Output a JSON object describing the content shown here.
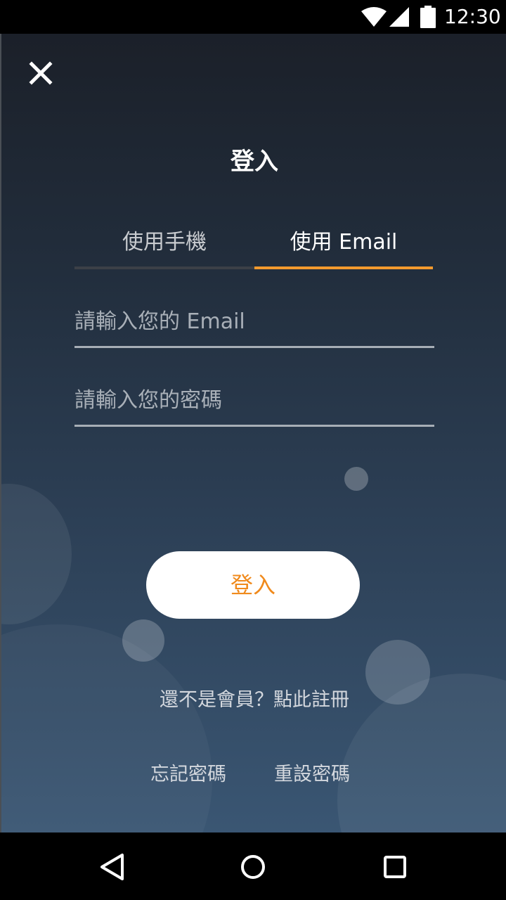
{
  "status_bar": {
    "time": "12:30",
    "icons": [
      "wifi-icon",
      "cell-signal-icon",
      "battery-icon"
    ]
  },
  "header": {
    "close_icon": "close-icon",
    "title": "登入"
  },
  "tabs": [
    {
      "label": "使用手機",
      "active": false
    },
    {
      "label": "使用 Email",
      "active": true
    }
  ],
  "form": {
    "email_placeholder": "請輸入您的 Email",
    "password_placeholder": "請輸入您的密碼",
    "submit_label": "登入"
  },
  "links": {
    "register": "還不是會員？點此註冊",
    "forgot_password": "忘記密碼",
    "reset_password": "重設密碼"
  },
  "colors": {
    "accent": "#f39a2e",
    "button_text": "#f08a1c",
    "background_top": "#1b2029",
    "background_bottom": "#3a5673"
  },
  "nav_bar": {
    "icons": [
      "back-icon",
      "home-icon",
      "recent-apps-icon"
    ]
  }
}
